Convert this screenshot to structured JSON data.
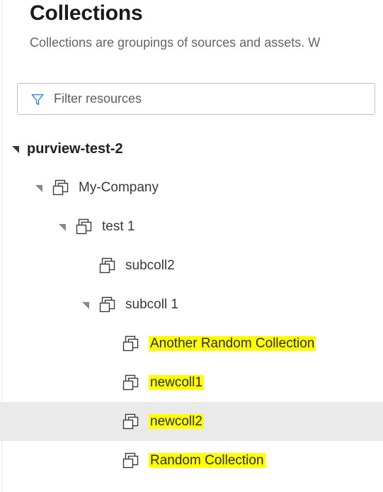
{
  "header": {
    "title": "Collections",
    "subtitle": "Collections are groupings of sources and assets. W"
  },
  "filter": {
    "icon": "filter-funnel-icon",
    "placeholder": "Filter resources",
    "value": ""
  },
  "colors": {
    "accent": "#0078d4",
    "highlight": "#ffff00",
    "hover_row": "#eaeaea",
    "text": "#323130",
    "subtitle_text": "#60666d",
    "border": "#bfbfbf"
  },
  "tree": {
    "items": [
      {
        "label": "purview-test-2",
        "level": 0,
        "expanded": true,
        "has_children": true,
        "has_icon": false,
        "root": true,
        "highlighted": false,
        "hovered": false,
        "chevron_tone": "dark"
      },
      {
        "label": "My-Company",
        "level": 1,
        "expanded": true,
        "has_children": true,
        "has_icon": true,
        "root": false,
        "highlighted": false,
        "hovered": false,
        "chevron_tone": "light"
      },
      {
        "label": "test 1",
        "level": 2,
        "expanded": true,
        "has_children": true,
        "has_icon": true,
        "root": false,
        "highlighted": false,
        "hovered": false,
        "chevron_tone": "light"
      },
      {
        "label": "subcoll2",
        "level": 3,
        "expanded": false,
        "has_children": false,
        "has_icon": true,
        "root": false,
        "highlighted": false,
        "hovered": false,
        "chevron_tone": "none"
      },
      {
        "label": "subcoll 1",
        "level": 3,
        "expanded": true,
        "has_children": true,
        "has_icon": true,
        "root": false,
        "highlighted": false,
        "hovered": false,
        "chevron_tone": "light"
      },
      {
        "label": "Another Random Collection",
        "level": 4,
        "expanded": false,
        "has_children": false,
        "has_icon": true,
        "root": false,
        "highlighted": true,
        "hovered": false,
        "chevron_tone": "none"
      },
      {
        "label": "newcoll1",
        "level": 4,
        "expanded": false,
        "has_children": false,
        "has_icon": true,
        "root": false,
        "highlighted": true,
        "hovered": false,
        "chevron_tone": "none"
      },
      {
        "label": "newcoll2",
        "level": 4,
        "expanded": false,
        "has_children": false,
        "has_icon": true,
        "root": false,
        "highlighted": true,
        "hovered": true,
        "chevron_tone": "none"
      },
      {
        "label": "Random Collection",
        "level": 4,
        "expanded": false,
        "has_children": false,
        "has_icon": true,
        "root": false,
        "highlighted": true,
        "hovered": false,
        "chevron_tone": "none"
      }
    ]
  }
}
